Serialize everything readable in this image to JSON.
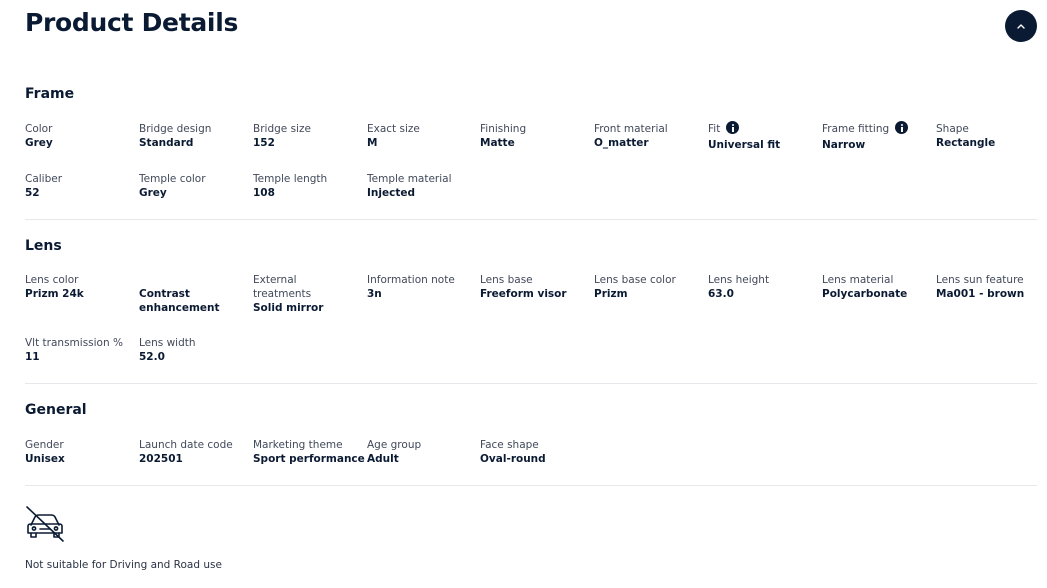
{
  "header": {
    "title": "Product Details",
    "collapse_icon": "chevron-up-icon"
  },
  "frame": {
    "title": "Frame",
    "rows": [
      [
        {
          "label": "Color",
          "value": "Grey"
        },
        {
          "label": "Bridge design",
          "value": "Standard"
        },
        {
          "label": "Bridge size",
          "value": "152"
        },
        {
          "label": "Exact size",
          "value": "M"
        },
        {
          "label": "Finishing",
          "value": "Matte"
        },
        {
          "label": "Front material",
          "value": "O_matter"
        },
        {
          "label": "Fit",
          "value": "Universal fit"
        },
        {
          "label": "Frame fitting",
          "value": "Narrow"
        },
        {
          "label": "Shape",
          "value": "Rectangle"
        }
      ],
      [
        {
          "label": "Caliber",
          "value": "52"
        },
        {
          "label": "Temple color",
          "value": "Grey"
        },
        {
          "label": "Temple length",
          "value": "108"
        },
        {
          "label": "Temple material",
          "value": "Injected"
        }
      ]
    ]
  },
  "lens": {
    "title": "Lens",
    "rows": [
      [
        {
          "label": "Lens color",
          "value": "Prizm 24k"
        },
        {
          "label": "",
          "value": "Contrast enhancement"
        },
        {
          "label": "External treatments",
          "value": "Solid mirror"
        },
        {
          "label": "Information note",
          "value": "3n"
        },
        {
          "label": "Lens base",
          "value": "Freeform visor"
        },
        {
          "label": "Lens base color",
          "value": "Prizm"
        },
        {
          "label": "Lens height",
          "value": "63.0"
        },
        {
          "label": "Lens material",
          "value": "Polycarbonate"
        },
        {
          "label": "Lens sun feature",
          "value": "Ma001 - brown"
        }
      ],
      [
        {
          "label": "Vlt transmission %",
          "value": "11"
        },
        {
          "label": "Lens width",
          "value": "52.0"
        }
      ]
    ]
  },
  "general": {
    "title": "General",
    "rows": [
      [
        {
          "label": "Gender",
          "value": "Unisex"
        },
        {
          "label": "Launch date code",
          "value": "202501"
        },
        {
          "label": "Marketing theme",
          "value": "Sport performance"
        },
        {
          "label": "Age group",
          "value": "Adult"
        },
        {
          "label": "Face shape",
          "value": "Oval-round"
        }
      ]
    ]
  },
  "warning": {
    "icon": "no-driving-icon",
    "text": "Not suitable for Driving and Road use"
  }
}
